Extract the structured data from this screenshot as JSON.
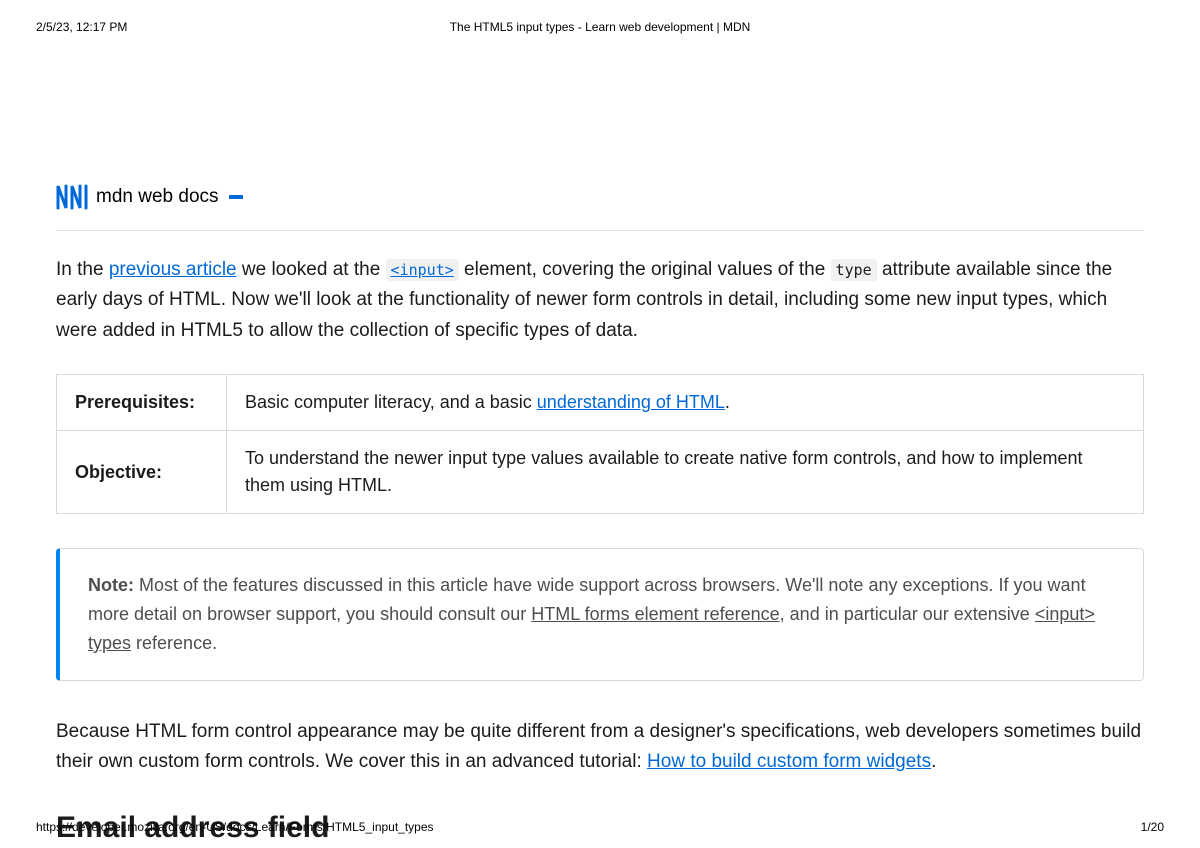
{
  "print": {
    "timestamp": "2/5/23, 12:17 PM",
    "title": "The HTML5 input types - Learn web development | MDN",
    "url": "https://developer.mozilla.org/en-US/docs/Learn/Forms/HTML5_input_types",
    "page": "1/20"
  },
  "logo": {
    "brand": "mdn web docs"
  },
  "intro": {
    "t1": "In the ",
    "link1": "previous article",
    "t2": " we looked at the ",
    "code1": "<input>",
    "t3": " element, covering the original values of the ",
    "code2": "type",
    "t4": " attribute available since the early days of HTML. Now we'll look at the functionality of newer form controls in detail, including some new input types, which were added in HTML5 to allow the collection of specific types of data."
  },
  "table": {
    "row1_label": "Prerequisites:",
    "row1_t1": "Basic computer literacy, and a basic ",
    "row1_link": "understanding of HTML",
    "row1_t2": ".",
    "row2_label": "Objective:",
    "row2_val": "To understand the newer input type values available to create native form controls, and how to implement them using HTML."
  },
  "note": {
    "label": "Note:",
    "t1": " Most of the features discussed in this article have wide support across browsers. We'll note any exceptions. If you want more detail on browser support, you should consult our ",
    "link1": "HTML forms element reference",
    "t2": ", and in particular our extensive ",
    "link2": "<input> types",
    "t3": " reference."
  },
  "para2": {
    "t1": "Because HTML form control appearance may be quite different from a designer's specifications, web developers sometimes build their own custom form controls. We cover this in an advanced tutorial: ",
    "link": "How to build custom form widgets",
    "t2": "."
  },
  "heading": "Email address field"
}
